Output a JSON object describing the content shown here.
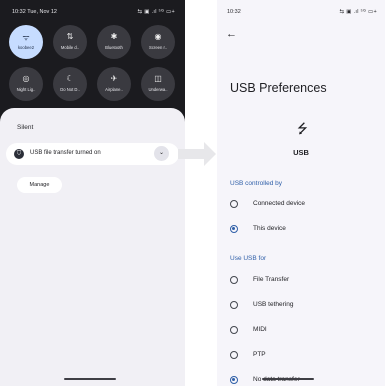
{
  "left": {
    "status": {
      "time": "10:32 Tue, Nov 12",
      "icons": "⇆ ▣ .ıl ⁵ᴳ ▭+"
    },
    "tiles": [
      {
        "label": "koobee2",
        "icon": "wifi-icon",
        "glyph": "ᯤ",
        "active": true
      },
      {
        "label": "Mobile d..",
        "icon": "mobile-data-icon",
        "glyph": "⇅",
        "active": false
      },
      {
        "label": "Bluetooth",
        "icon": "bluetooth-icon",
        "glyph": "✱",
        "active": false
      },
      {
        "label": "Screen r..",
        "icon": "screen-record-icon",
        "glyph": "◉",
        "active": false
      },
      {
        "label": "Night Lig..",
        "icon": "night-light-icon",
        "glyph": "◎",
        "active": false
      },
      {
        "label": "Do Not D..",
        "icon": "do-not-disturb-icon",
        "glyph": "☾",
        "active": false
      },
      {
        "label": "Airplane..",
        "icon": "airplane-icon",
        "glyph": "✈",
        "active": false
      },
      {
        "label": "Underwa..",
        "icon": "camera-icon",
        "glyph": "◫",
        "active": false
      }
    ],
    "section_title": "Silent",
    "notification": {
      "text": "USB file transfer turned on",
      "icon_glyph": "⛉",
      "expand_glyph": "⌄"
    },
    "manage_label": "Manage"
  },
  "right": {
    "status": {
      "time": "10:32",
      "icons": "⇆ ▣ .ıl ⁵ᴳ ▭+"
    },
    "back_glyph": "←",
    "title": "USB Preferences",
    "usb_glyph": "⭍",
    "usb_label": "USB",
    "controlled_header": "USB controlled by",
    "controlled_options": [
      {
        "label": "Connected device",
        "checked": false
      },
      {
        "label": "This device",
        "checked": true
      }
    ],
    "use_header": "Use USB for",
    "use_options": [
      {
        "label": "File Transfer",
        "checked": false
      },
      {
        "label": "USB tethering",
        "checked": false
      },
      {
        "label": "MIDI",
        "checked": false
      },
      {
        "label": "PTP",
        "checked": false
      },
      {
        "label": "No data transfer",
        "checked": true
      }
    ]
  },
  "colors": {
    "accent": "#2f5fa8",
    "active_tile": "#c6dcff",
    "shade_bg": "#1b1b1f"
  }
}
